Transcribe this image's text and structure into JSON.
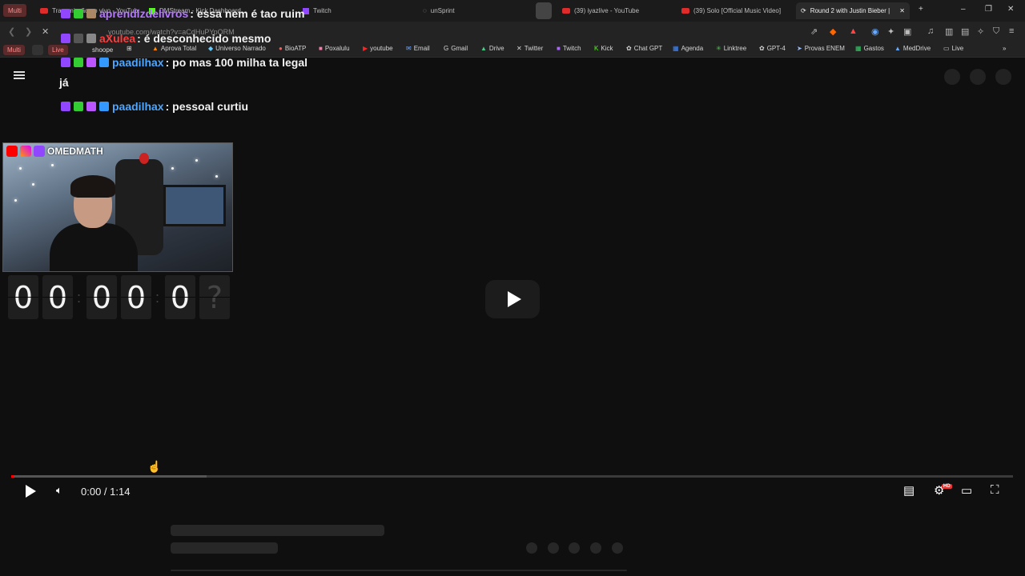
{
  "browser": {
    "multi_label": "Multi",
    "tabs": [
      {
        "label": "Transmissão ao vivo - YouTube",
        "icon": "youtube-icon"
      },
      {
        "label": "DMStream - Kick Dashboard",
        "icon": "kick-icon"
      },
      {
        "label": "Twitch",
        "icon": "twitch-icon"
      },
      {
        "label": "unSprint",
        "icon": "globe-icon"
      },
      {
        "label": "(39) iyazlive - YouTube",
        "icon": "youtube-icon"
      },
      {
        "label": "(39) Solo [Official Music Video]",
        "icon": "youtube-icon"
      },
      {
        "label": "Round 2 with Justin Bieber |",
        "icon": "refresh-icon",
        "active": true
      }
    ],
    "url": "youtube.com/watch?v=aCdHuPYpQRM",
    "bookmark_pills": [
      "Multi",
      "Live",
      "shoope"
    ],
    "bookmarks": [
      "Aprova Total",
      "Universo Narrado",
      "BioATP",
      "Poxalulu",
      "youtube",
      "Email",
      "Gmail",
      "Drive",
      "Twitter",
      "Twitch",
      "Kick",
      "Chat GPT",
      "Agenda",
      "Linktree",
      "GPT-4",
      "Provas ENEM",
      "Gastos",
      "MedDrive",
      "Live"
    ]
  },
  "chat": [
    {
      "user": "aprendizdelivros",
      "message": ": essa nem é tao ruim",
      "color": "#b678ff"
    },
    {
      "user": "aXulea",
      "message": ": é desconhecido mesmo",
      "color": "#ff3b3b"
    },
    {
      "user": "paadilhax",
      "message": ": po mas 100 milha ta legal",
      "color": "#4da6ff"
    },
    {
      "continuation": "já"
    },
    {
      "user": "paadilhax",
      "message": ": pessoal curtiu",
      "color": "#4da6ff"
    }
  ],
  "webcam": {
    "channel_label": "OMEDMATH"
  },
  "timer": {
    "digits": [
      "0",
      "0",
      "0",
      "0",
      "0",
      "?"
    ]
  },
  "player": {
    "time_display": "0:00 / 1:14",
    "progress_fraction": 0.0,
    "quality_badge": "HD"
  }
}
